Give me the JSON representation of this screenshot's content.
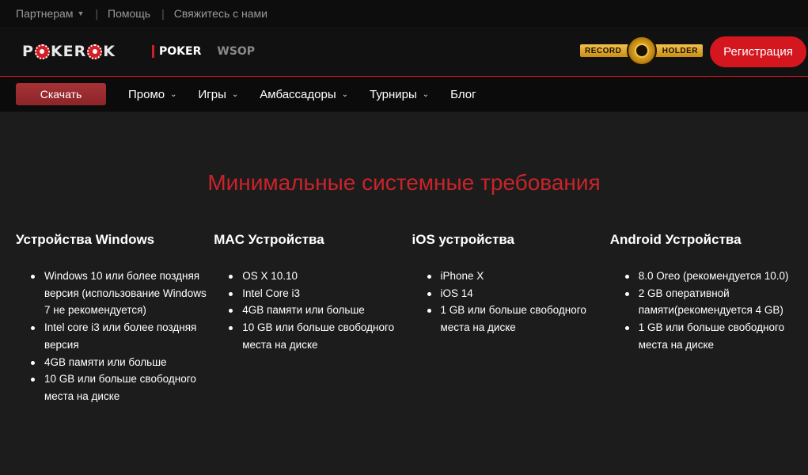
{
  "topbar": {
    "partners": "Партнерам",
    "help": "Помощь",
    "contact": "Свяжитесь с нами"
  },
  "header": {
    "logo_left": "P",
    "logo_right": "KER",
    "logo_end": "K",
    "tab_poker": "POKER",
    "tab_wsop": "WSOP",
    "badge_left": "RECORD",
    "badge_right": "HOLDER",
    "register": "Регистрация"
  },
  "nav": {
    "download": "Скачать",
    "items": [
      {
        "label": "Промо",
        "has_dropdown": true
      },
      {
        "label": "Игры",
        "has_dropdown": true
      },
      {
        "label": "Амбассадоры",
        "has_dropdown": true
      },
      {
        "label": "Турниры",
        "has_dropdown": true
      },
      {
        "label": "Блог",
        "has_dropdown": false
      }
    ]
  },
  "main": {
    "title": "Минимальные системные требования",
    "columns": [
      {
        "heading": "Устройства Windows",
        "items": [
          "Windows 10 или более поздняя версия (использование Windows 7 не рекомендуется)",
          "Intel core i3 или более поздняя версия",
          "4GB памяти или больше",
          "10 GB или больше свободного места на диске"
        ]
      },
      {
        "heading": "MAC Устройства",
        "items": [
          "OS X 10.10",
          "Intel Core i3",
          "4GB памяти или больше",
          "10 GB или больше свободного места на диске"
        ]
      },
      {
        "heading": "iOS устройства",
        "items": [
          "iPhone X",
          "iOS 14",
          "1 GB или больше свободного места на диске"
        ]
      },
      {
        "heading": "Android Устройства",
        "items": [
          "8.0 Oreo (рекомендуется 10.0)",
          "2 GB оперативной памяти(рекомендуется 4 GB)",
          "1 GB или больше свободного места на диске"
        ]
      }
    ]
  },
  "colors": {
    "accent_red": "#d4161f",
    "title_red": "#c8242a",
    "background": "#1c1c1c"
  }
}
